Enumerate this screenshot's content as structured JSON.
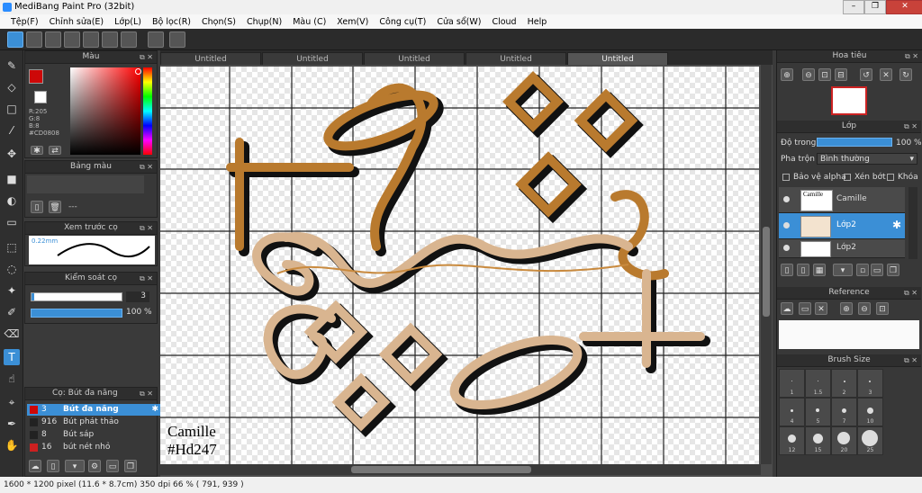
{
  "app": {
    "title": "MediBang Paint Pro (32bit)"
  },
  "menu": [
    "Tệp(F)",
    "Chỉnh sửa(E)",
    "Lớp(L)",
    "Bộ lọc(R)",
    "Chọn(S)",
    "Chụp(N)",
    "Màu (C)",
    "Xem(V)",
    "Công cụ(T)",
    "Cửa sổ(W)",
    "Cloud",
    "Help"
  ],
  "tabs": [
    "Untitled",
    "Untitled",
    "Untitled",
    "Untitled",
    "Untitled"
  ],
  "panels": {
    "color": {
      "title": "Màu",
      "r": "R:205",
      "g": "G:8",
      "b": "B:8",
      "hex": "#CD0808",
      "primary_color": "#CD0808"
    },
    "palette": {
      "title": "Bảng màu",
      "empty": "---"
    },
    "preview": {
      "title": "Xem trước cọ",
      "size": "0.22mm"
    },
    "brush_control": {
      "title": "Kiểm soát cọ",
      "size": "3",
      "opacity": "100 %"
    },
    "brush_list": {
      "title": "Cọ: Bút đa năng",
      "items": [
        {
          "size": "3",
          "name": "Bút đa năng",
          "color": "#CD0808"
        },
        {
          "size": "916",
          "name": "Bút phát thảo",
          "color": "#222222"
        },
        {
          "size": "8",
          "name": "Bút sáp",
          "color": "#222222"
        },
        {
          "size": "16",
          "name": "bút nét nhỏ",
          "color": "#CD2020"
        }
      ]
    }
  },
  "right": {
    "navigator": {
      "title": "Hoa tiêu"
    },
    "layer": {
      "title": "Lớp",
      "opacity_label": "Độ trong",
      "opacity_value": "100 %",
      "blend_label": "Pha trộn",
      "blend_value": "Bình thường",
      "protect_alpha": "Bảo vệ alpha",
      "clipping": "Xén bớt",
      "lock": "Khóa",
      "layers": [
        {
          "name": "Camille",
          "thumb_text": "Camille\n#Hd247"
        },
        {
          "name": "Lớp2"
        },
        {
          "name": "Lớp2"
        }
      ]
    },
    "reference": {
      "title": "Reference"
    },
    "brush_size": {
      "title": "Brush Size",
      "sizes": [
        "1",
        "1.5",
        "2",
        "3",
        "4",
        "5",
        "7",
        "10",
        "12",
        "15",
        "20",
        "25"
      ]
    }
  },
  "canvas": {
    "signature_line1": "Camille",
    "signature_line2": "#Hd247",
    "artwork_text": "Other"
  },
  "status": {
    "text": "1600 * 1200 pixel    (11.6 * 8.7cm)   350 dpi   66 %   ( 791, 939 )"
  }
}
